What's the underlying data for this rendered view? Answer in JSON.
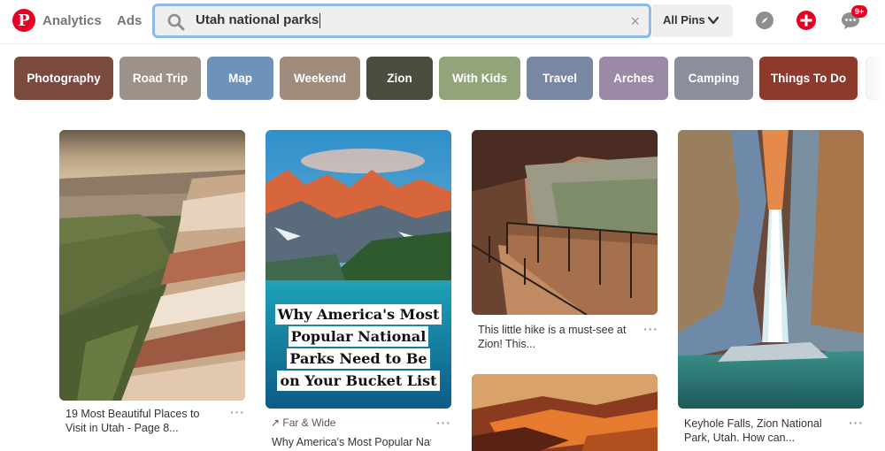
{
  "nav": {
    "analytics": "Analytics",
    "ads": "Ads"
  },
  "search": {
    "query": "Utah national parks",
    "clear": "×",
    "scope": "All Pins"
  },
  "notifications": {
    "badge": "9+"
  },
  "chips": [
    {
      "label": "Photography",
      "color": "#7a4a3f"
    },
    {
      "label": "Road Trip",
      "color": "#9c9289"
    },
    {
      "label": "Map",
      "color": "#6f93b8"
    },
    {
      "label": "Weekend",
      "color": "#a08c7c"
    },
    {
      "label": "Zion",
      "color": "#4a4d3e"
    },
    {
      "label": "With Kids",
      "color": "#93a47a"
    },
    {
      "label": "Travel",
      "color": "#7887a4"
    },
    {
      "label": "Arches",
      "color": "#9a8aa6"
    },
    {
      "label": "Camping",
      "color": "#8d8e9c"
    },
    {
      "label": "Things To Do",
      "color": "#8c3a2c"
    }
  ],
  "pins": [
    {
      "description": "19 Most Beautiful Places to Visit in Utah - Page 8...",
      "more": "···"
    },
    {
      "overlay_lines": [
        "Why America's Most",
        "Popular National",
        "Parks Need to Be",
        "on Your Bucket List"
      ],
      "source": "Far & Wide",
      "description": "Why America's Most Popular National Parks Need to Be...",
      "more": "···"
    },
    {
      "description": "This little hike is a must-see at Zion! This...",
      "more": "···"
    },
    {
      "description": "Keyhole Falls, Zion National Park, Utah. How can...",
      "more": "···"
    }
  ]
}
